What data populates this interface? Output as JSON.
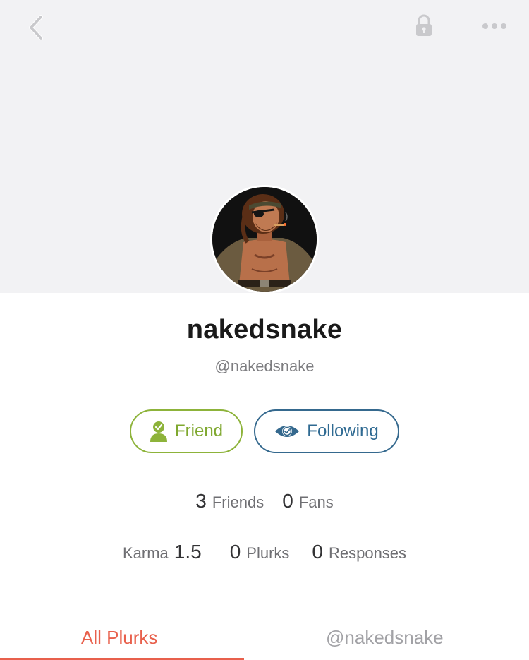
{
  "header": {
    "back_icon": "chevron-left-icon",
    "lock_icon": "lock-icon",
    "more_icon": "ellipsis-icon"
  },
  "profile": {
    "display_name": "nakedsnake",
    "handle": "@nakedsnake",
    "avatar": "illustrated-portrait-avatar"
  },
  "actions": {
    "friend_label": "Friend",
    "following_label": "Following",
    "friend_color": "#8db33a",
    "following_color": "#35698e"
  },
  "stats": {
    "friends_count": "3",
    "friends_label": "Friends",
    "fans_count": "0",
    "fans_label": "Fans",
    "karma_label": "Karma",
    "karma_value": "1.5",
    "plurks_count": "0",
    "plurks_label": "Plurks",
    "responses_count": "0",
    "responses_label": "Responses"
  },
  "tabs": [
    {
      "label": "All Plurks",
      "active": true
    },
    {
      "label": "@nakedsnake",
      "active": false
    }
  ],
  "colors": {
    "accent": "#e8604c",
    "cover_bg": "#f2f2f4"
  }
}
